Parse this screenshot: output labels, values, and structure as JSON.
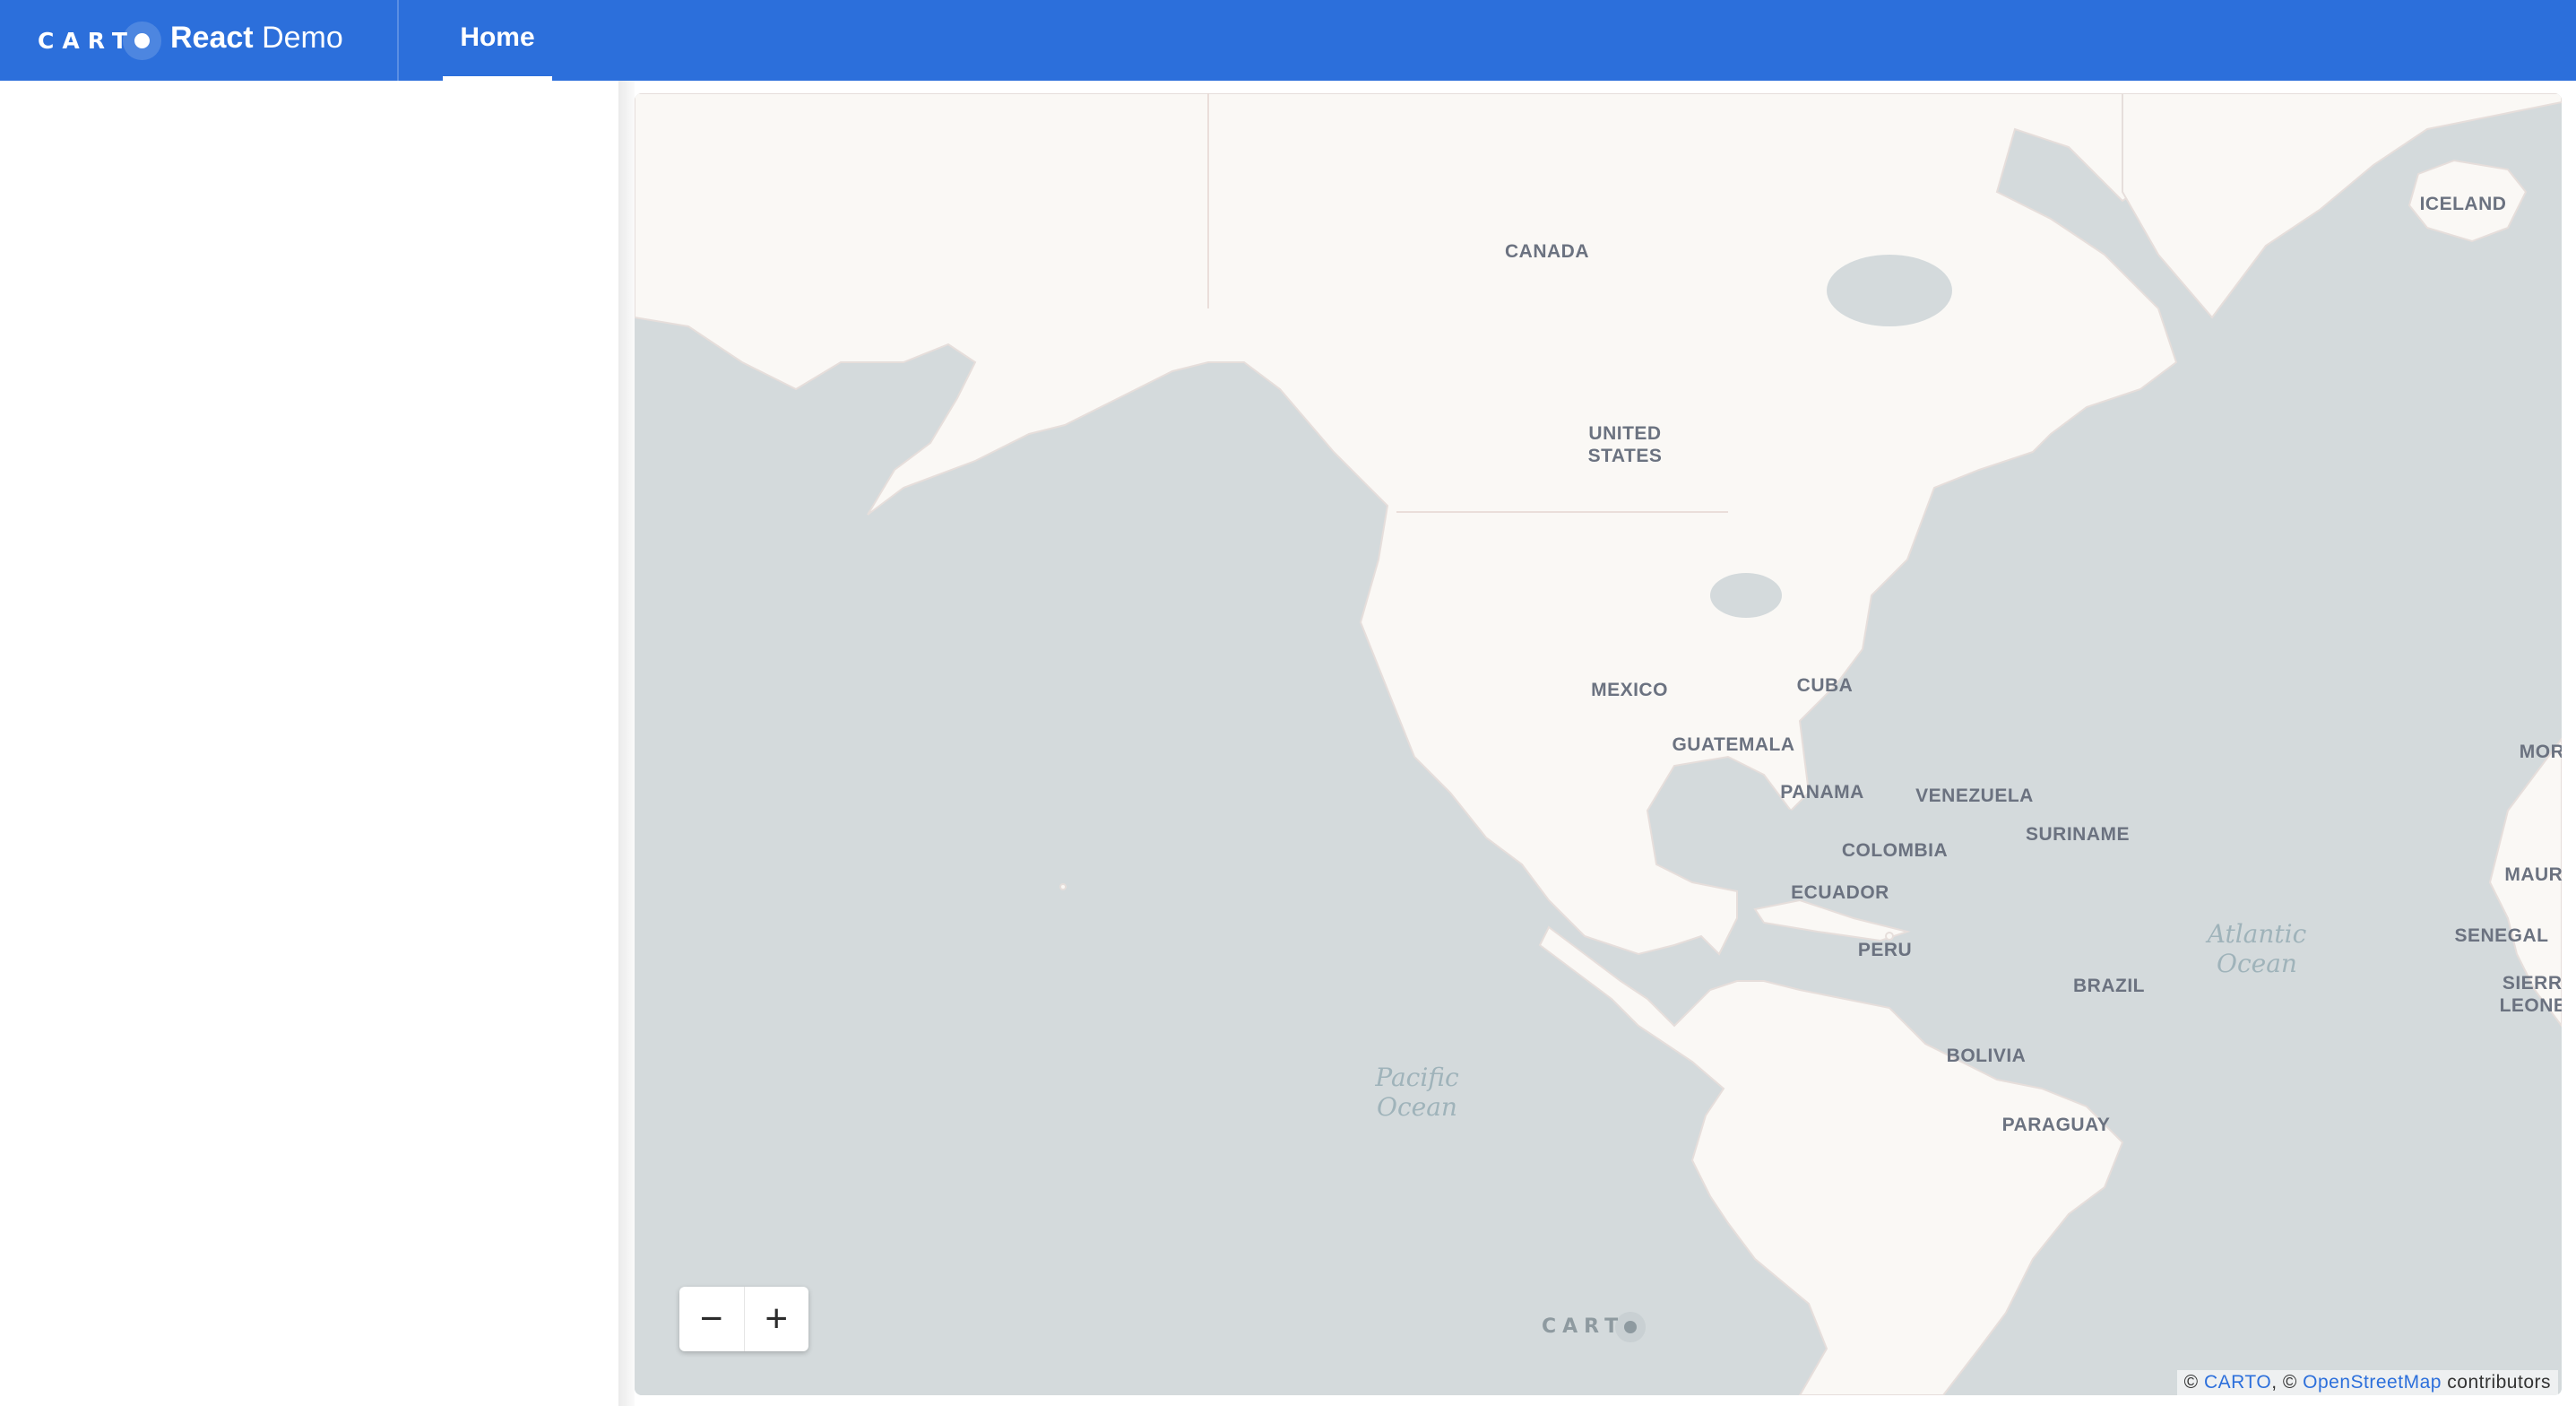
{
  "header": {
    "logo_text": "CART",
    "title_bold": "React",
    "title_light": "Demo",
    "tabs": [
      {
        "label": "Home",
        "active": true
      }
    ]
  },
  "map": {
    "country_labels": [
      "ICELAND",
      "CANADA",
      "UNITED",
      "STATES",
      "MEXICO",
      "CUBA",
      "GUATEMALA",
      "PANAMA",
      "VENEZUELA",
      "COLOMBIA",
      "SURINAME",
      "ECUADOR",
      "PERU",
      "BRAZIL",
      "BOLIVIA",
      "PARAGUAY",
      "MOR",
      "MAURI",
      "SENEGAL",
      "SIERRA",
      "LEONE"
    ],
    "ocean_labels": [
      {
        "line1": "Atlantic",
        "line2": "Ocean"
      },
      {
        "line1": "Pacific",
        "line2": "Ocean"
      }
    ],
    "zoom_out": "−",
    "zoom_in": "+",
    "watermark": "CART",
    "attribution": {
      "prefix": "© ",
      "carto": "CARTO",
      "middle": ", © ",
      "osm": "OpenStreetMap",
      "suffix": " contributors"
    }
  },
  "colors": {
    "appbar": "#2C6FDB",
    "water": "#D4DADC",
    "land": "#FAF8F5",
    "label": "#6B7280"
  }
}
